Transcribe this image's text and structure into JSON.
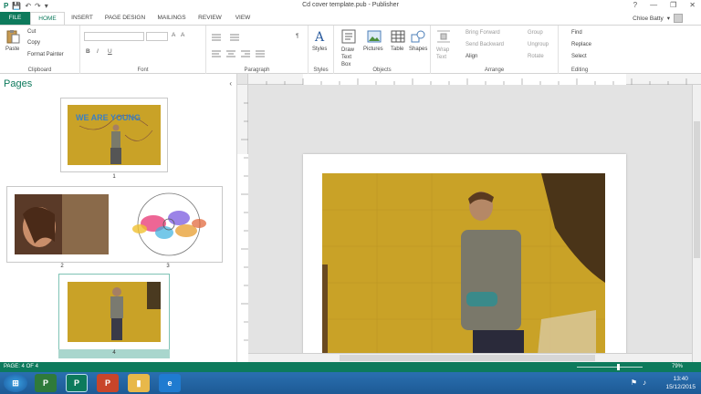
{
  "window": {
    "title": "Cd cover template.pub - Publisher",
    "help": "?",
    "minimize": "—",
    "restore": "❐",
    "close": "✕"
  },
  "qat": {
    "save": "💾",
    "undo": "↶",
    "redo": "↷",
    "more": "▾"
  },
  "tabs": [
    {
      "label": "FILE"
    },
    {
      "label": "HOME"
    },
    {
      "label": "INSERT"
    },
    {
      "label": "PAGE DESIGN"
    },
    {
      "label": "MAILINGS"
    },
    {
      "label": "REVIEW"
    },
    {
      "label": "VIEW"
    }
  ],
  "user": {
    "name": "Chloe Batty",
    "caret": "▾"
  },
  "ribbon": {
    "clipboard": {
      "label": "Clipboard",
      "paste": "Paste",
      "cut": "Cut",
      "copy": "Copy",
      "format_painter": "Format Painter"
    },
    "font": {
      "label": "Font",
      "bold": "B",
      "italic": "I",
      "underline": "U",
      "grow": "A",
      "shrink": "A"
    },
    "paragraph": {
      "label": "Paragraph",
      "pilcrow": "¶"
    },
    "styles": {
      "label": "Styles",
      "styles_btn": "Styles"
    },
    "objects": {
      "label": "Objects",
      "draw_text_box": "Draw Text Box",
      "pictures": "Pictures",
      "table": "Table",
      "shapes": "Shapes"
    },
    "arrange": {
      "label": "Arrange",
      "wrap_text": "Wrap Text",
      "bring_forward": "Bring Forward",
      "send_backward": "Send Backward",
      "align": "Align",
      "group": "Group",
      "ungroup": "Ungroup",
      "rotate": "Rotate"
    },
    "editing": {
      "label": "Editing",
      "find": "Find",
      "replace": "Replace",
      "select": "Select"
    }
  },
  "pages_pane": {
    "title": "Pages",
    "collapse": "‹",
    "pages": [
      {
        "number": "1",
        "caption": "WE ARE YOUNG"
      },
      {
        "number": "2"
      },
      {
        "number": "3"
      },
      {
        "number": "4"
      }
    ]
  },
  "status": {
    "page": "PAGE: 4 OF 4",
    "zoom": "79%"
  },
  "taskbar": {
    "start": "⊞",
    "clock_time": "13:40",
    "clock_date": "15/12/2015"
  },
  "colors": {
    "accent": "#0d7a5c",
    "photo_yellow": "#c9a227",
    "taskbar": "#1d5a95"
  }
}
